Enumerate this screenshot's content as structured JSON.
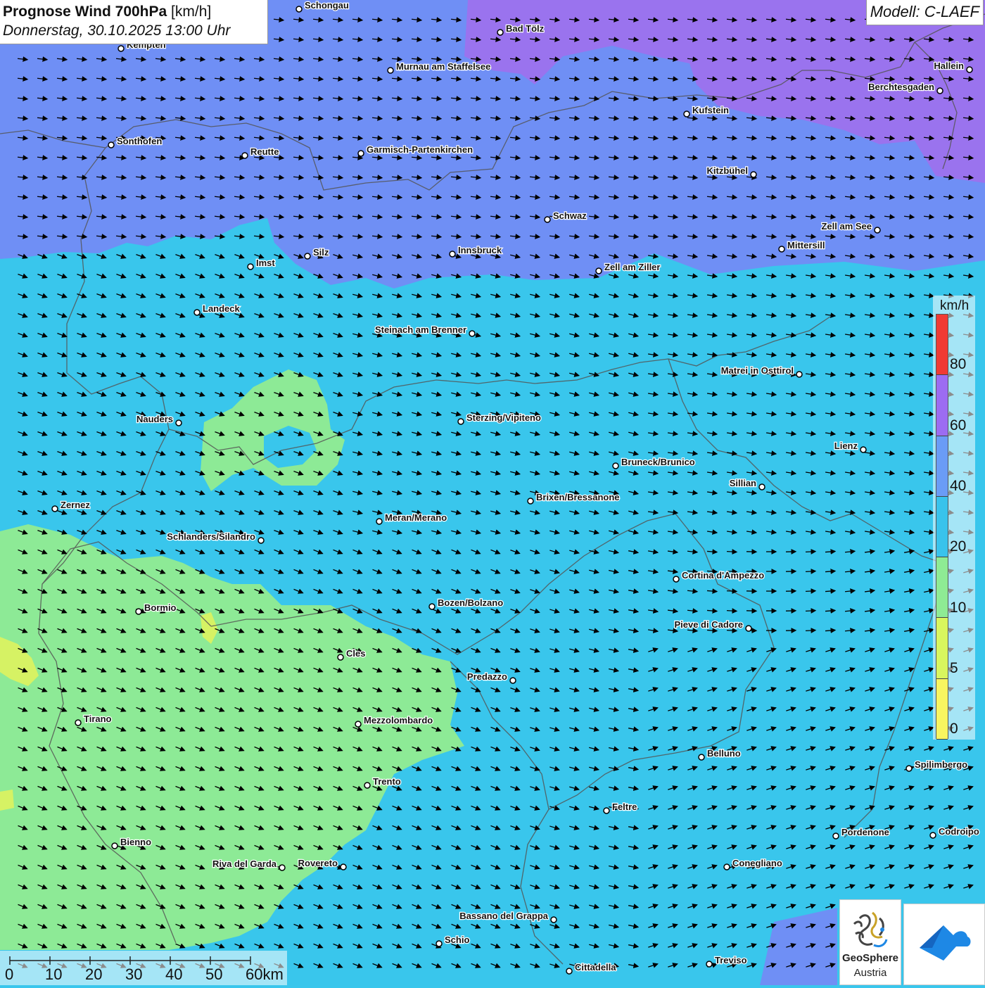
{
  "title": {
    "main": "Prognose Wind 700hPa",
    "unit": "[km/h]",
    "date": "Donnerstag, 30.10.2025 13:00 Uhr"
  },
  "model": "Modell: C-LAEF",
  "legend": {
    "unit": "km/h",
    "ticks": [
      "80",
      "60",
      "40",
      "20",
      "10",
      "5",
      "0"
    ],
    "colors": [
      "#f03a33",
      "#9c6cf2",
      "#6a9cf6",
      "#38c3ec",
      "#8eeb94",
      "#d8f65e",
      "#f8f560"
    ]
  },
  "scale": {
    "labels": [
      "0",
      "10",
      "20",
      "30",
      "40",
      "50",
      "60km"
    ]
  },
  "logo": {
    "name": "GeoSphere",
    "country": "Austria",
    "colors": {
      "dark": "#444444",
      "gold": "#c9a227",
      "blue": "#1e88e5"
    }
  },
  "map_colors": {
    "purple": "#9a73ee",
    "blue40": "#6f8ff5",
    "cyan": "#39c6ec",
    "green": "#8dea96",
    "yellowgreen": "#d6f264",
    "arrow": "#000000",
    "border": "#555555"
  },
  "cities": [
    {
      "name": "Schongau"
    },
    {
      "name": "Bad Tölz"
    },
    {
      "name": "Kempten"
    },
    {
      "name": "Murnau am Staffelsee"
    },
    {
      "name": "Hallein"
    },
    {
      "name": "Berchtesgaden"
    },
    {
      "name": "Kufstein"
    },
    {
      "name": "Sonthofen"
    },
    {
      "name": "Reutte"
    },
    {
      "name": "Garmisch-Partenkirchen"
    },
    {
      "name": "Kitzbühel"
    },
    {
      "name": "Schwaz"
    },
    {
      "name": "Zell am See"
    },
    {
      "name": "Mittersill"
    },
    {
      "name": "Innsbruck"
    },
    {
      "name": "Silz"
    },
    {
      "name": "Imst"
    },
    {
      "name": "Zell am Ziller"
    },
    {
      "name": "Landeck"
    },
    {
      "name": "Steinach am Brenner"
    },
    {
      "name": "Matrei in Osttirol"
    },
    {
      "name": "Nauders"
    },
    {
      "name": "Sterzing/Vipiteno"
    },
    {
      "name": "Lienz"
    },
    {
      "name": "Bruneck/Brunico"
    },
    {
      "name": "Sillian"
    },
    {
      "name": "Brixen/Bressanone"
    },
    {
      "name": "Zernez"
    },
    {
      "name": "Meran/Merano"
    },
    {
      "name": "Schlanders/Silandro"
    },
    {
      "name": "Cortina d'Ampezzo"
    },
    {
      "name": "Bozen/Bolzano"
    },
    {
      "name": "Bormio"
    },
    {
      "name": "Pieve di Cadore"
    },
    {
      "name": "Cles"
    },
    {
      "name": "Predazzo"
    },
    {
      "name": "Tirano"
    },
    {
      "name": "Mezzolombardo"
    },
    {
      "name": "Belluno"
    },
    {
      "name": "Spilimbergo"
    },
    {
      "name": "Trento"
    },
    {
      "name": "Feltre"
    },
    {
      "name": "Pordenone"
    },
    {
      "name": "Codroipo"
    },
    {
      "name": "Bienno"
    },
    {
      "name": "Riva del Garda"
    },
    {
      "name": "Rovereto"
    },
    {
      "name": "Conegliano"
    },
    {
      "name": "Bassano del Grappa"
    },
    {
      "name": "Schio"
    },
    {
      "name": "Treviso"
    },
    {
      "name": "Cittadella"
    }
  ]
}
